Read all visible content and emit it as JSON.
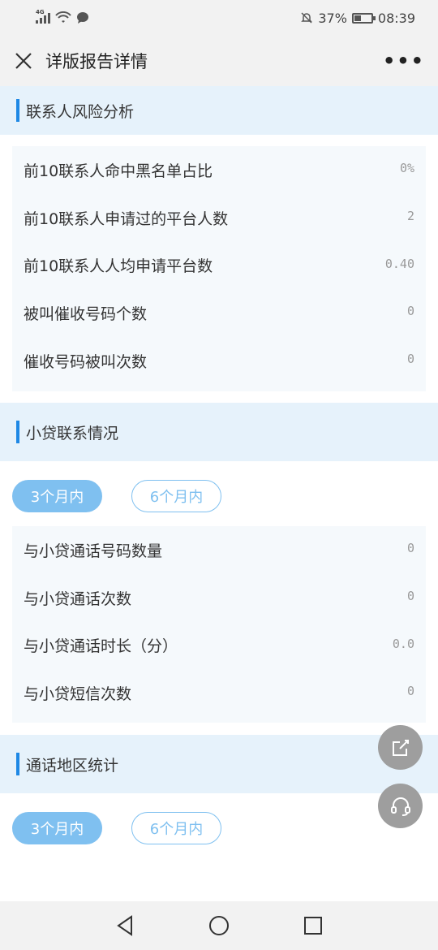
{
  "status": {
    "network": "4G",
    "battery": "37%",
    "time": "08:39"
  },
  "header": {
    "title": "详版报告详情",
    "more": "•••"
  },
  "contact_risk": {
    "title": "联系人风险分析",
    "rows": [
      {
        "label": "前10联系人命中黑名单占比",
        "value": "0%"
      },
      {
        "label": "前10联系人申请过的平台人数",
        "value": "2"
      },
      {
        "label": "前10联系人人均申请平台数",
        "value": "0.40"
      },
      {
        "label": "被叫催收号码个数",
        "value": "0"
      },
      {
        "label": "催收号码被叫次数",
        "value": "0"
      }
    ]
  },
  "loan_contact": {
    "title": "小贷联系情况",
    "tabs": [
      "3个月内",
      "6个月内"
    ],
    "rows": [
      {
        "label": "与小贷通话号码数量",
        "value": "0"
      },
      {
        "label": "与小贷通话次数",
        "value": "0"
      },
      {
        "label": "与小贷通话时长（分）",
        "value": "0.0"
      },
      {
        "label": "与小贷短信次数",
        "value": "0"
      }
    ]
  },
  "call_region": {
    "title": "通话地区统计",
    "tabs": [
      "3个月内",
      "6个月内"
    ]
  },
  "colors": {
    "accent": "#1e88e5",
    "tab_active": "#7fc0f0",
    "section_bg": "#e6f2fb"
  }
}
